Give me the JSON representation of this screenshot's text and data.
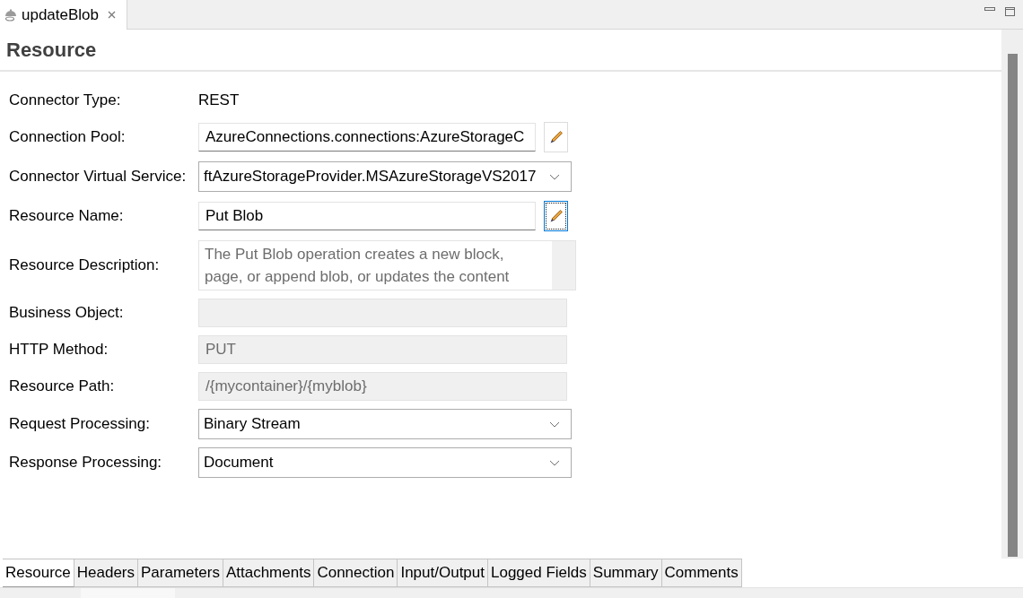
{
  "editor_tabs": [
    {
      "label": "updateBlob",
      "selected": true
    }
  ],
  "title": "Resource",
  "fields": [
    {
      "kind": "static",
      "label": "Connector Type:",
      "value": "REST"
    },
    {
      "kind": "text_button",
      "label": "Connection Pool:",
      "value": "AzureConnections.connections:AzureStorageC",
      "button_focused": false
    },
    {
      "kind": "combo",
      "label": "Connector Virtual Service:",
      "value": "ftAzureStorageProvider.MSAzureStorageVS2017"
    },
    {
      "kind": "text_button",
      "label": "Resource Name:",
      "value": "Put Blob",
      "button_focused": true
    },
    {
      "kind": "textarea",
      "label": "Resource Description:",
      "value": "The Put Blob operation creates a new block,\npage, or append blob, or updates the content",
      "read_only": true
    },
    {
      "kind": "text",
      "label": "Business Object:",
      "disabled": true
    },
    {
      "kind": "text",
      "label": "HTTP Method:",
      "value": "PUT",
      "disabled": true
    },
    {
      "kind": "text",
      "label": "Resource Path:",
      "value": "/{mycontainer}/{myblob}",
      "disabled": true
    },
    {
      "kind": "combo",
      "label": "Request Processing:",
      "value": "Binary Stream"
    },
    {
      "kind": "combo",
      "label": "Response Processing:",
      "value": "Document"
    }
  ],
  "bottom_tabs": [
    {
      "label": "Resource",
      "selected": true
    },
    {
      "label": "Headers",
      "selected": false
    },
    {
      "label": "Parameters",
      "selected": false
    },
    {
      "label": "Attachments",
      "selected": false
    },
    {
      "label": "Connection",
      "selected": false
    },
    {
      "label": "Input/Output",
      "selected": false
    },
    {
      "label": "Logged Fields",
      "selected": false
    },
    {
      "label": "Summary",
      "selected": false
    },
    {
      "label": "Comments",
      "selected": false
    }
  ]
}
